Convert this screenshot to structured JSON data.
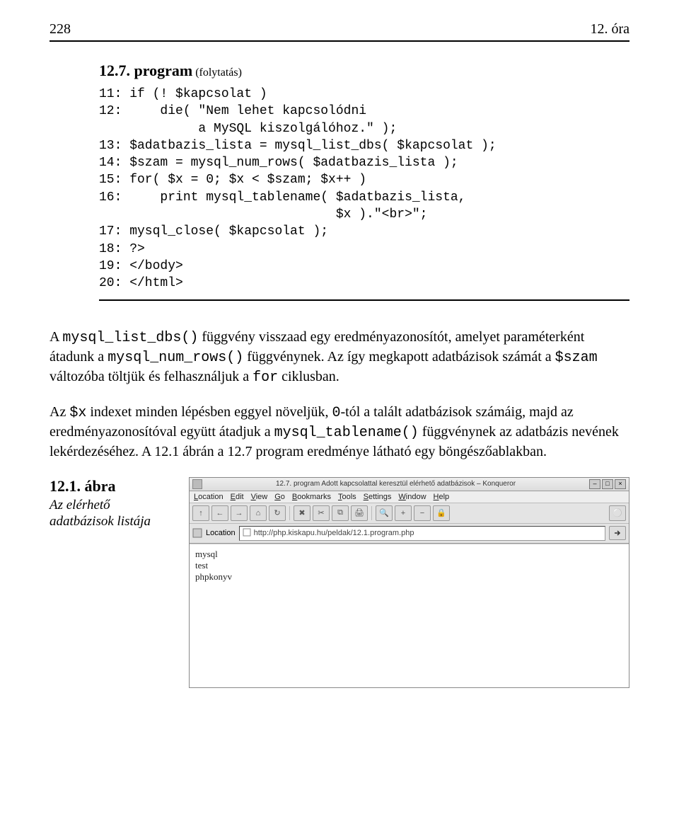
{
  "header": {
    "page_number": "228",
    "chapter": "12. óra"
  },
  "program": {
    "number": "12.7. program",
    "continuation": "(folytatás)",
    "lines": [
      "11: if (! $kapcsolat )",
      "12:     die( \"Nem lehet kapcsolódni",
      "             a MySQL kiszolgálóhoz.\" );",
      "13: $adatbazis_lista = mysql_list_dbs( $kapcsolat );",
      "14: $szam = mysql_num_rows( $adatbazis_lista );",
      "15: for( $x = 0; $x < $szam; $x++ )",
      "16:     print mysql_tablename( $adatbazis_lista,",
      "                               $x ).\"<br>\";",
      "17: mysql_close( $kapcsolat );",
      "18: ?>",
      "19: </body>",
      "20: </html>"
    ]
  },
  "paragraphs": {
    "p1_a": "A ",
    "p1_code1": "mysql_list_dbs()",
    "p1_b": " függvény visszaad egy eredményazonosítót, amelyet paraméterként átadunk a ",
    "p1_code2": "mysql_num_rows()",
    "p1_c": " függvénynek. Az így megkapott adatbázisok számát a ",
    "p1_code3": "$szam",
    "p1_d": " változóba töltjük és felhasználjuk a ",
    "p1_code4": "for",
    "p1_e": " ciklusban.",
    "p2_a": "Az ",
    "p2_code1": "$x",
    "p2_b": " indexet minden lépésben eggyel növeljük, ",
    "p2_code2": "0",
    "p2_c": "-tól a talált adatbázisok számáig, majd az eredményazonosítóval együtt átadjuk a ",
    "p2_code3": "mysql_tablename()",
    "p2_d": " függvénynek az adatbázis nevének lekérdezéséhez. A 12.1 ábrán a 12.7 program eredménye látható egy böngészőablakban."
  },
  "figure": {
    "number": "12.1. ábra",
    "caption": "Az elérhető adatbázisok listája"
  },
  "browser": {
    "title": "12.7. program Adott kapcsolattal keresztül elérhető adatbázisok – Konqueror",
    "menus": [
      "Location",
      "Edit",
      "View",
      "Go",
      "Bookmarks",
      "Tools",
      "Settings",
      "Window",
      "Help"
    ],
    "toolbar_icons": [
      "↑",
      "←",
      "→",
      "⌂",
      "↻",
      "✖",
      "✂",
      "⧉",
      "🖨",
      "🔍",
      "+",
      "−",
      "🔒",
      "⚪"
    ],
    "location_label": "Location",
    "url": "http://php.kiskapu.hu/peldak/12.1.program.php",
    "output_lines": [
      "mysql",
      "test",
      "phpkonyv"
    ]
  }
}
